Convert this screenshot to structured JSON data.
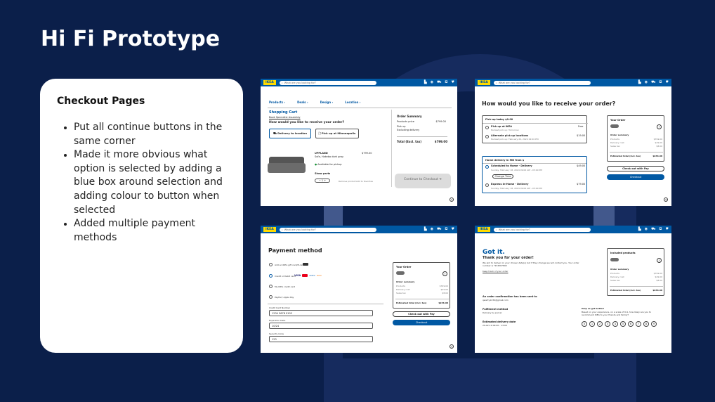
{
  "slide": {
    "title": "Hi Fi Prototype"
  },
  "notes": {
    "heading": "Checkout Pages",
    "bullets": [
      "Put all continue buttons in the same corner",
      "Made it more obvious what option is selected by adding a blue box around selection and adding colour to button when selected",
      "Added multiple payment methods"
    ]
  },
  "header": {
    "logo": "IKEA",
    "search_placeholder": "What are you looking for?",
    "icons": [
      "store-icon",
      "account-icon",
      "delivery-icon",
      "cart-icon",
      "heart-icon"
    ]
  },
  "cart": {
    "nav": [
      "Products",
      "Deals",
      "Design",
      "Location"
    ],
    "title": "Shopping Cart",
    "link": "Book Specialist Assembly",
    "question": "How would you like to receive your order?",
    "delivery_btn": "Delivery to location",
    "pickup_btn": "Pick up at Minneapolis",
    "product_name": "UPPLAND",
    "product_desc": "Sofa, Hakebo dark gray",
    "product_price": "$799.00",
    "availability": "Available for pickup",
    "show_parts": "Show parts",
    "qty": "1",
    "remove": "Remove product",
    "save": "Add to favorites",
    "summary_title": "Order Summary",
    "summary_rows": [
      {
        "label": "Products price",
        "value": "$799.00"
      },
      {
        "label": "Pick up",
        "value": ""
      },
      {
        "label": "Excluding delivery",
        "value": ""
      }
    ],
    "total_label": "Total (Excl. tax)",
    "total_value": "$799.00",
    "checkout_btn": "Continue to Checkout"
  },
  "receive": {
    "title": "How would you like to receive your order?",
    "pickup_header": "Pick-up today $0.00",
    "options": [
      {
        "title": "Pick up at IKEA",
        "sub": "Earliest pick up: Tomorrow",
        "price": "Free"
      },
      {
        "title": "Alternate pick up locations",
        "sub": "Earliest pick up: February 20, 2024 02:00 PM",
        "price": "$19.00"
      }
    ],
    "delivery_header": "Home delivery in MN from $",
    "delivery_options": [
      {
        "title": "Scheduled to Home - Delivery",
        "sub": "Sunday, February 18, 2024 09:00 AM - 05:00 PM",
        "price": "$49.00"
      },
      {
        "title": "Express In-Home - Delivery",
        "sub": "Sunday, February 18, 2024 09:00 AM - 05:00 PM",
        "price": "$79.00"
      }
    ],
    "change_time": "Change Time",
    "order_title": "Your Order",
    "order_summary": "Order summary",
    "order_rows": [
      "Products",
      "Delivery cost",
      "Sales tax"
    ],
    "order_values": [
      "$799.00",
      "$49.00",
      "$8.00"
    ],
    "total_label": "Estimated total (incl. tax)",
    "total_value": "$936.98",
    "pay_btn": "Check out with  Pay",
    "checkout_btn": "Checkout"
  },
  "payment": {
    "title": "Payment method",
    "options": [
      "Add an IKEA gift card/E-card",
      "Credit or Debit card",
      "My IKEA credit card",
      "PayPal / Apple Pay"
    ],
    "card_brands": [
      "VISA",
      "MC",
      "AMEX",
      "DISC"
    ],
    "fields": [
      {
        "label": "Credit Card Number",
        "value": "1234 5678 9102"
      },
      {
        "label": "Expiration Date",
        "value": "10/24"
      },
      {
        "label": "Security Code",
        "value": "123"
      }
    ],
    "order_title": "Your Order",
    "order_summary": "Order summary",
    "order_rows": [
      "Products",
      "Delivery cost",
      "Sales tax"
    ],
    "order_values": [
      "$799.00",
      "$49.00",
      "$8.00"
    ],
    "total_label": "Estimated total (incl. tax)",
    "total_value": "$936.98",
    "pay_btn": "Check out with  Pay",
    "checkout_btn": "Checkout"
  },
  "confirm": {
    "title": "Got it.",
    "subtitle": "Thank you for your order!",
    "body": "We aim to deliver on your chosen date(s) but if they change we will contact you. Your order number is *234567890",
    "track_link": "Keep track of your order",
    "email_title": "An order confirmation has been sent to",
    "email": "qwerty1234@gmail.com",
    "fulfilment_title": "Fulfilment method",
    "fulfilment_value": "Delivery by parcel",
    "eta_title": "Estimated delivery date",
    "eta_value": "20-02-19 09:00 - 13:00",
    "feedback_title": "Help us get better!",
    "feedback_body": "Based on your experience, on a scale of 0-9, how likely are you to recommend IKEA to your friends and family?",
    "scale": [
      "0",
      "1",
      "2",
      "3",
      "4",
      "5",
      "6",
      "7",
      "8",
      "9"
    ],
    "included_title": "Included products",
    "order_summary": "Order summary",
    "order_rows": [
      "Products",
      "Delivery cost",
      "Sales tax"
    ],
    "order_values": [
      "$799.00",
      "$49.00",
      "$8.00"
    ],
    "total_label": "Estimated total (incl. tax)",
    "total_value": "$936.98"
  },
  "colors": {
    "background": "#0b1f4a",
    "ikea_blue": "#0058a3",
    "ikea_yellow": "#ffdb00"
  }
}
